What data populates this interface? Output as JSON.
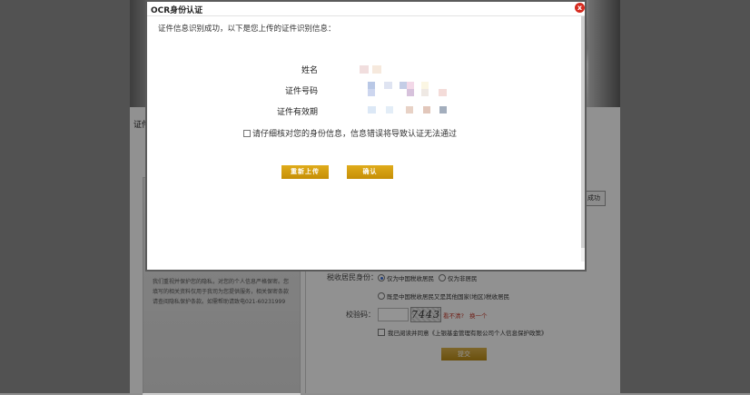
{
  "modal": {
    "title": "OCR身份认证",
    "close_label": "x",
    "intro": "证件信息识别成功，以下是您上传的证件识别信息：",
    "fields": [
      {
        "label": "姓名"
      },
      {
        "label": "证件号码"
      },
      {
        "label": "证件有效期"
      }
    ],
    "consent_text": "请仔细核对您的身份信息，信息错误将导致认证无法通过",
    "reupload_label": "重新上传",
    "confirm_label": "确认"
  },
  "background": {
    "left_fragment": "证件",
    "right_button": "成功",
    "privacy_text": "我们重视并保护您的隐私，对您的个人信息严格保密。您填写的相关资料仅用于我司为您提供服务，相关保密条款请查阅隐私保护条款。如需帮助请致电021-60231999",
    "tax_label": "税收居民身份：",
    "tax_options": [
      "仅为中国税收居民",
      "仅为非居民",
      "既是中国税收居民又是其他国家(地区)税收居民"
    ],
    "captcha_label": "校验码：",
    "captcha_value": "7443",
    "captcha_unclear": "看不清?",
    "captcha_change": "换一个",
    "agree_text": "我已阅读并同意《上银基金管理有限公司个人信息保护政策》",
    "submit_label": "提交"
  },
  "colors": {
    "accent": "#c58e06",
    "close": "#d62b1f"
  }
}
